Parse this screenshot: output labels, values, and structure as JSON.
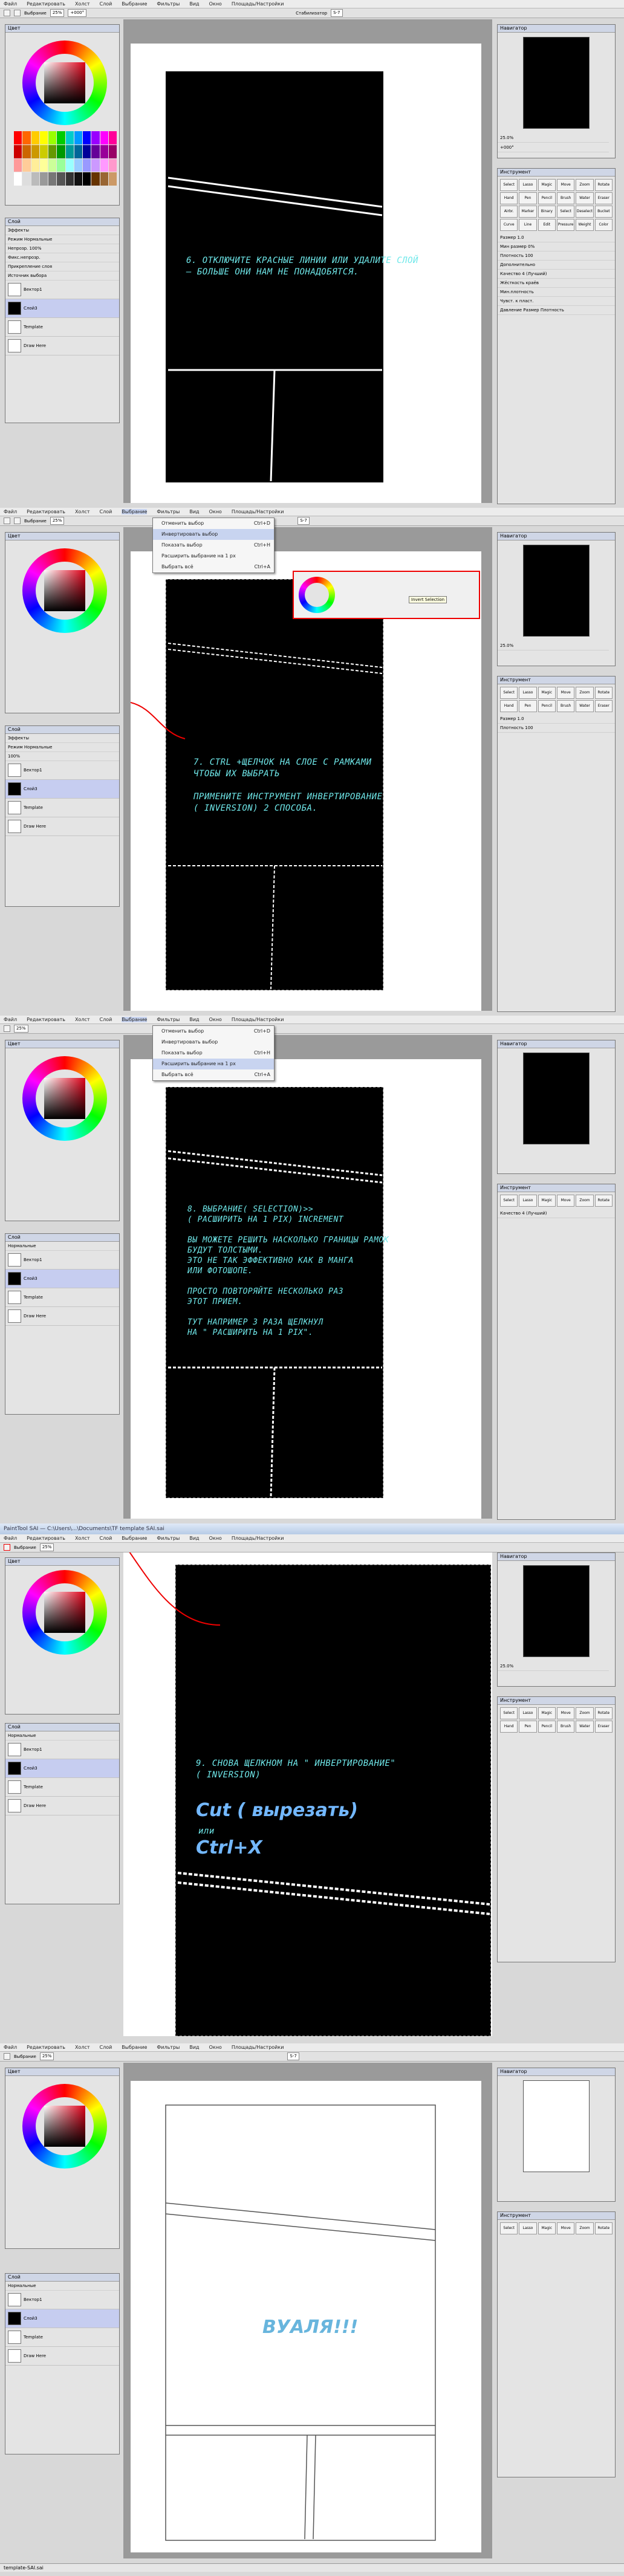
{
  "app": {
    "title": "PaintTool SAI",
    "file_path": "C:\\Users\\...\\Documents\\TF template SAI.sai",
    "status": "template-SAI.sai"
  },
  "menu": [
    "Файл",
    "Редактировать",
    "Холст",
    "Слой",
    "Выбрание",
    "Фильтры",
    "Вид",
    "Окно",
    "Площадь/Настройки"
  ],
  "toolbar": {
    "selection_label": "Выбрание",
    "zoom": "25%",
    "angle": "+000°",
    "stabilizer_label": "Стабилизатор",
    "stabilizer_value": "S-7"
  },
  "left": {
    "color_title": "Цвет",
    "layer_title": "Слой",
    "effects_label": "Эффекты",
    "mode_label": "Режим",
    "mode_value": "Нормальные",
    "opacity_label": "Непрозр.",
    "opacity_value": "100%",
    "checks": [
      "Фикс.непрозр.",
      "Прикрепление слоя",
      "Источник выбора"
    ],
    "layers": [
      {
        "name": "Вектор1",
        "info": "Нормальные 100%"
      },
      {
        "name": "Слой3",
        "info": "Нормальные 100%"
      },
      {
        "name": "Template",
        "info": "Нормальные 100% – Lock"
      },
      {
        "name": "Draw Here",
        "info": "Нормальные 100%"
      }
    ]
  },
  "right": {
    "navigator_title": "Навигатор",
    "zoom": "25.0%",
    "angle": "+000°",
    "tools_title": "Инструмент",
    "tools": [
      "Select",
      "Lasso",
      "Magic",
      "Move",
      "Zoom",
      "Rotate",
      "Hand",
      "Pen",
      "Pencil",
      "Brush",
      "Water",
      "Eraser",
      "Airbr.",
      "Marker",
      "Binary",
      "Select",
      "Deselect",
      "Bucket",
      "Curve",
      "Line",
      "Edit",
      "Pressure",
      "Weight",
      "Color"
    ],
    "size_label": "Размер",
    "size_value": "1.0",
    "min_size_label": "Мин размер",
    "min_size_value": "0%",
    "density_label": "Плотность",
    "density_value": "100",
    "advanced_label": "Дополнительно",
    "quality_label": "Качество",
    "quality_value": "4 (Лучший)",
    "edge_label": "Жёсткость краёв",
    "min_density_label": "Мин.плотность",
    "mix_label": "Чувст. к пласт.",
    "pressure_label": "Давление",
    "pressure_check": "Размер",
    "density_check": "Плотность"
  },
  "step6": {
    "text": "6. ОТКЛЮЧИТЕ КРАСНЫЕ ЛИНИИ ИЛИ УДАЛИТЕ СЛОЙ\n– БОЛЬШЕ ОНИ НАМ НЕ ПОНАДОБЯТСЯ."
  },
  "step7": {
    "text": "7. CTRL +ЩЕЛЧОК НА СЛОЕ С РАМКАМИ\nЧТОБЫ ИХ ВЫБРАТЬ\n\nПРИМЕНИТЕ ИНСТРУМЕНТ ИНВЕРТИРОВАНИЕ\n( INVERSION) 2 СПОСОБА."
  },
  "step8": {
    "text": "8. ВЫБРАНИЕ( SELECTION)>>\n( РАСШИРИТЬ НА 1 PIX) INCREMENT\n\nВЫ МОЖЕТЕ РЕШИТЬ НАСКОЛЬКО ГРАНИЦЫ РАМОК\nБУДУТ ТОЛСТЫМИ.\nЭТО НЕ ТАК ЭФФЕКТИВНО КАК В МАНГА\nИЛИ ФОТОШОПЕ.\n\nПРОСТО ПОВТОРЯЙТЕ НЕСКОЛЬКО РАЗ\nЭТОТ ПРИЕМ.\n\nТУТ НАПРИМЕР 3 РАЗА ЩЕЛКНУЛ\nНА \" РАСШИРИТЬ НА 1 PIX\"."
  },
  "step9": {
    "text": "9. СНОВА ЩЕЛКНОМ НА \" ИНВЕРТИРОВАНИЕ\"\n( INVERSION)",
    "cut": "Cut ( вырезать)",
    "or": "или",
    "shortcut": "Ctrl+X"
  },
  "final": {
    "text": "ВУАЛЯ!!!"
  },
  "select_menu": {
    "items": [
      {
        "label": "Отменить выбор",
        "shortcut": "Ctrl+D"
      },
      {
        "label": "Инвертировать выбор",
        "shortcut": ""
      },
      {
        "label": "Показать выбор",
        "shortcut": "Ctrl+H"
      },
      {
        "label": "Расширить выбрание на 1 px",
        "shortcut": ""
      },
      {
        "label": "Выбрать всё",
        "shortcut": "Ctrl+A"
      }
    ]
  },
  "inv_popup": {
    "label": "Invert Selection"
  }
}
